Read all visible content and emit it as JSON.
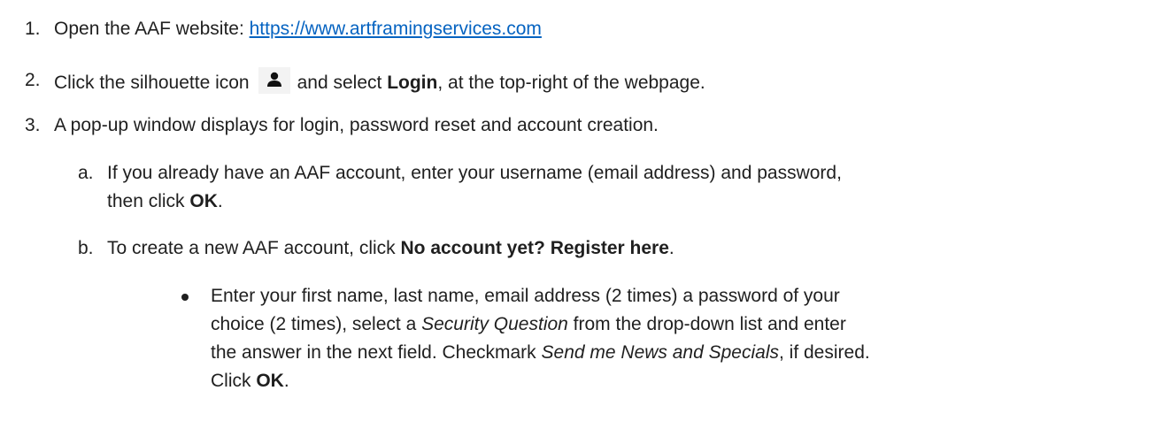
{
  "steps": [
    {
      "number": "1.",
      "text": "Open the AAF website: ",
      "link": "https://www.artframingservices.com"
    },
    {
      "number": "2.",
      "text_before_icon": "Click the silhouette icon",
      "text_after_icon": "and select ",
      "bold": "Login",
      "text_end": ", at the top-right of the webpage."
    },
    {
      "number": "3.",
      "text": "A pop-up window displays for login, password reset and account creation."
    }
  ],
  "substeps": [
    {
      "letter": "a.",
      "line1": "If you already have an AAF account, enter your username (email address) and password,",
      "line2_prefix": "then click ",
      "line2_bold": "OK",
      "line2_suffix": "."
    },
    {
      "letter": "b.",
      "prefix": "To create a new AAF account, click ",
      "bold": "No account yet? Register here",
      "suffix": "."
    }
  ],
  "bullet": {
    "line1": "Enter your first name, last name, email address (2 times) a password of your",
    "line2_prefix": "choice (2 times), select a ",
    "line2_italic": "Security Question",
    "line2_suffix": " from the drop-down list and enter",
    "line3_prefix": "the answer in the next field. Checkmark ",
    "line3_italic": "Send me News and Specials",
    "line3_suffix": ", if desired.",
    "line4_prefix": "Click ",
    "line4_bold": "OK",
    "line4_suffix": "."
  },
  "icons": {
    "silhouette": "user-silhouette-icon"
  }
}
